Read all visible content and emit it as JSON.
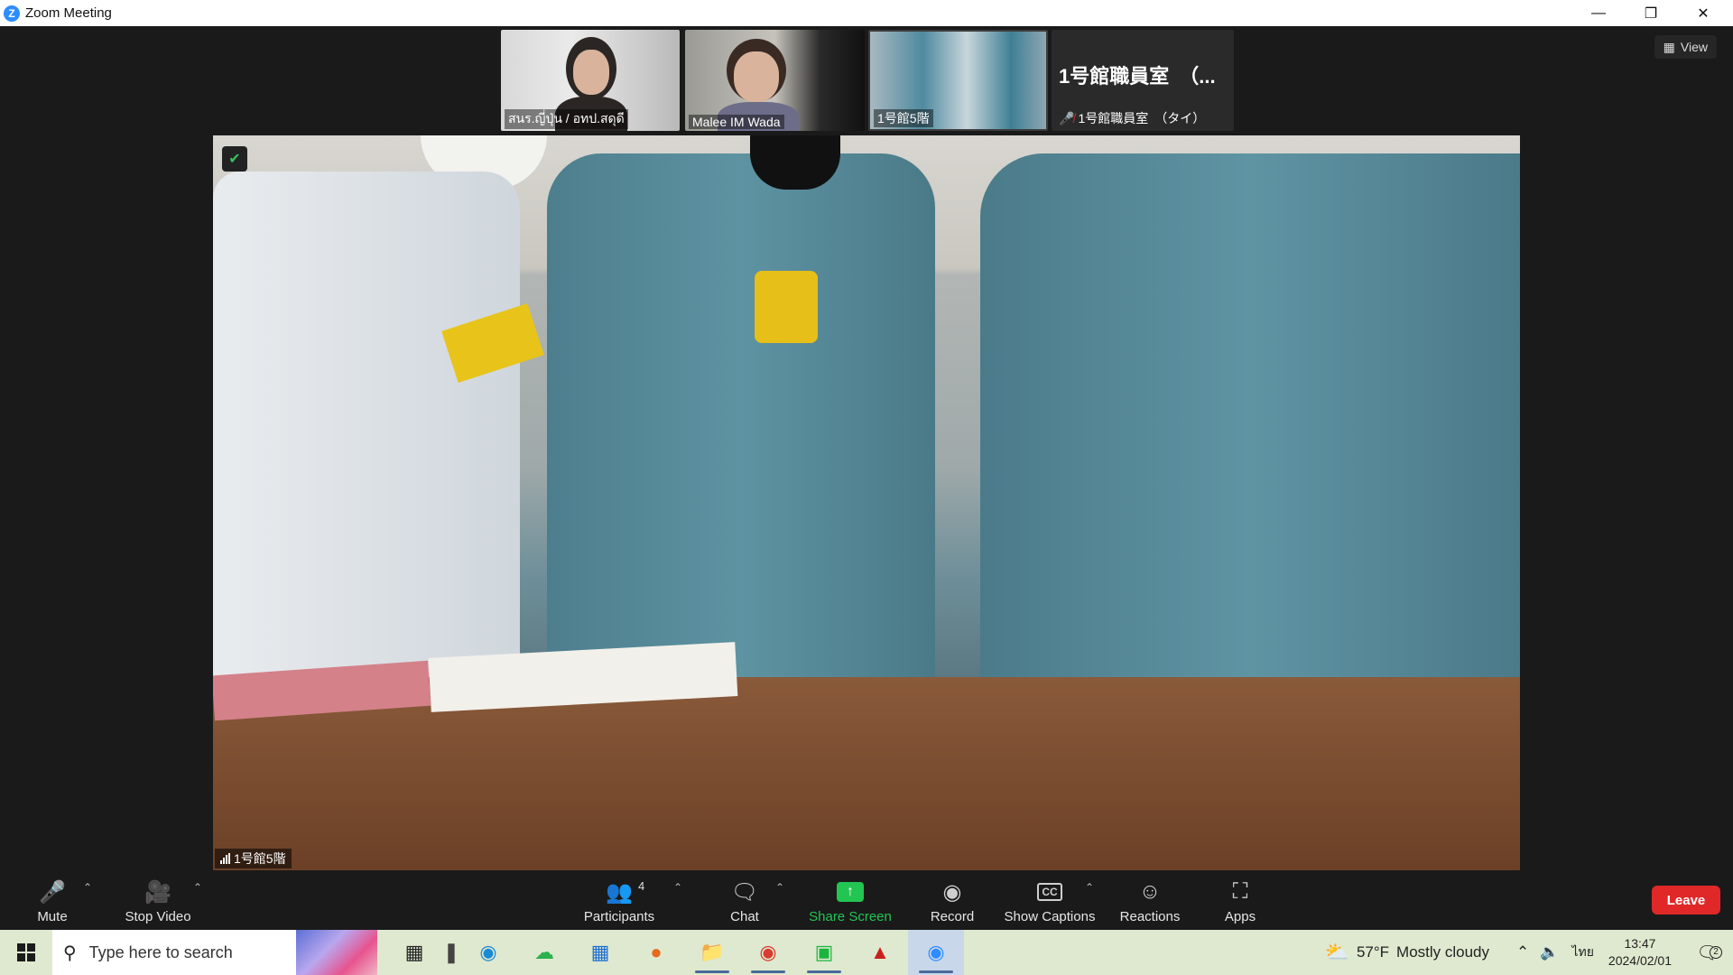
{
  "window": {
    "title": "Zoom Meeting",
    "app_icon_glyph": "Z"
  },
  "thumbnails": [
    {
      "name": "สนร.ญี่ปุ่น / อทป.สดุดี"
    },
    {
      "name": "Malee IM Wada"
    },
    {
      "name": "1号館5階"
    },
    {
      "title": "1号館職員室　（...",
      "name": "1号館職員室　（タイ）",
      "muted": true
    }
  ],
  "view_button": {
    "label": "View"
  },
  "main_video": {
    "label": "1号館5階",
    "security_icon": "shield-check-icon"
  },
  "toolbar": {
    "mute": "Mute",
    "stop_video": "Stop Video",
    "participants": "Participants",
    "participants_count": "4",
    "chat": "Chat",
    "share_screen": "Share Screen",
    "record": "Record",
    "show_captions": "Show Captions",
    "reactions": "Reactions",
    "apps": "Apps",
    "leave": "Leave",
    "accent_color": "#23c552",
    "leave_color": "#e02828"
  },
  "taskbar": {
    "search_placeholder": "Type here to search",
    "weather_temp": "57°F",
    "weather_text": "Mostly cloudy",
    "language": "ไทย",
    "time": "13:47",
    "date": "2024/02/01",
    "notification_count": "2"
  }
}
